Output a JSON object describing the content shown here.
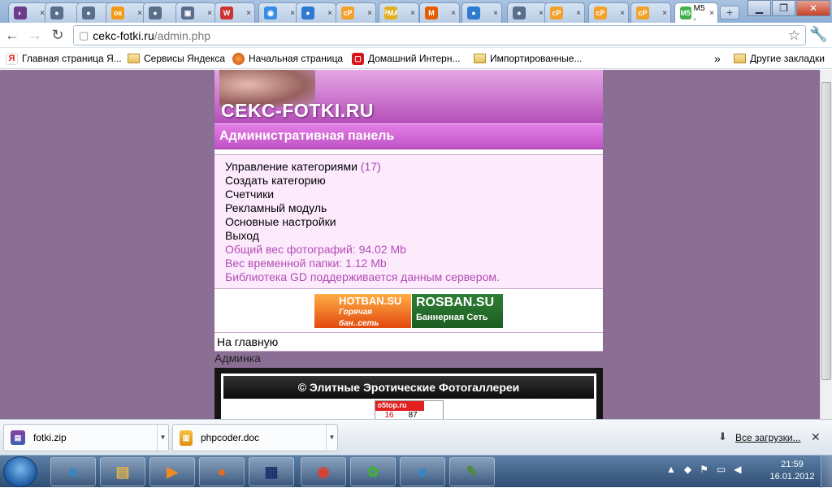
{
  "browser": {
    "tabs": [
      {
        "icon": "chrome-tab-icon",
        "color": "#6d3b8c",
        "glyph": "◐"
      },
      {
        "icon": "globe-tab-icon",
        "color": "#58708a",
        "glyph": "●"
      },
      {
        "icon": "globe-tab-icon",
        "color": "#58708a",
        "glyph": "●"
      },
      {
        "icon": "odnoklassniki-tab-icon",
        "color": "#f49a17",
        "glyph": "ок"
      },
      {
        "icon": "globe-tab-icon",
        "color": "#58708a",
        "glyph": "●"
      },
      {
        "icon": "document-tab-icon",
        "color": "#5b6b8d",
        "glyph": "▣"
      },
      {
        "icon": "colorful-tab-icon",
        "color": "#cc3333",
        "glyph": "W"
      },
      {
        "icon": "chat-tab-icon",
        "color": "#3a8ee6",
        "glyph": "◉"
      },
      {
        "icon": "globe-tab-icon",
        "color": "#2f7ad1",
        "glyph": "●"
      },
      {
        "icon": "cp-tab-icon",
        "color": "#f2a12a",
        "glyph": "cP"
      },
      {
        "icon": "pma-tab-icon",
        "color": "#e0b020",
        "glyph": "PMA"
      },
      {
        "icon": "m-tab-icon",
        "color": "#e65c00",
        "glyph": "M"
      },
      {
        "icon": "globe-tab-icon",
        "color": "#2f7ad1",
        "glyph": "●"
      },
      {
        "icon": "globe-tab-icon",
        "color": "#58708a",
        "glyph": "●"
      },
      {
        "icon": "cp-tab-icon",
        "color": "#f2a12a",
        "glyph": "cP"
      },
      {
        "icon": "cp-tab-icon",
        "color": "#f2a12a",
        "glyph": "cP"
      },
      {
        "icon": "cp-tab-icon",
        "color": "#f2a12a",
        "glyph": "cP"
      },
      {
        "icon": "active-tab-icon",
        "color": "#3fb04a",
        "glyph": "M5"
      }
    ],
    "active_tab_label": "M5 ,",
    "new_tab_label": "+",
    "window_buttons": {
      "minimize": "▁",
      "maximize": "❐",
      "close": "✕"
    },
    "back": "←",
    "forward": "→",
    "reload": "↻",
    "url_host": "cekc-fotki.ru",
    "url_path": "/admin.php",
    "star": "☆",
    "wrench": "🔧",
    "bookmarks": [
      {
        "label": "Главная страница Я...",
        "icon": "yandex-icon"
      },
      {
        "label": "Сервисы Яндекса",
        "icon": "folder-icon"
      },
      {
        "label": "Начальная страница",
        "icon": "firefox-icon"
      },
      {
        "label": "Домашний Интерн...",
        "icon": "home-internet-icon"
      },
      {
        "label": "Импортированные...",
        "icon": "folder-icon"
      }
    ],
    "bookmarks_more": "»",
    "other_bookmarks": "Другие закладки"
  },
  "site": {
    "logo": "CEKC-FOTKI.RU",
    "admin_title": "Административная панель",
    "menu": {
      "manage_categories": "Управление категориями",
      "categories_count": "(17)",
      "create_category": "Создать категорию",
      "counters": "Счетчики",
      "ad_module": "Рекламный модуль",
      "main_settings": "Основные настройки",
      "logout": "Выход"
    },
    "info": {
      "photos_weight": "Общий вес фотографий: 94.02 Mb",
      "temp_weight": "Вес временной папки: 1.12 Mb",
      "gd_support": "Библиотека GD поддерживается данным сервером."
    },
    "ads": {
      "hotban_title": "HOTBAN.SU",
      "hotban_sub1": "Горячая",
      "hotban_sub2": "бан..сеть",
      "rosban_title": "ROSBAN.SU",
      "rosban_sub": "Баннерная Сеть"
    },
    "home_link": "На главную",
    "adminka": "Админка",
    "footer_title": "© Элитные Эротические Фотогаллереи",
    "counter": {
      "brand": "o5top.ru",
      "left": "16",
      "right": "87"
    }
  },
  "downloads": {
    "items": [
      {
        "name": "fotki.zip",
        "icon": "winrar-icon"
      },
      {
        "name": "phpcoder.doc",
        "icon": "document-icon"
      }
    ],
    "all_label": "Все загрузки...",
    "close": "✕"
  },
  "taskbar": {
    "apps": [
      {
        "icon": "internet-explorer-icon",
        "glyph": "e",
        "color": "#1f8bd8"
      },
      {
        "icon": "file-explorer-icon",
        "glyph": "▤",
        "color": "#e0b34a"
      },
      {
        "icon": "media-player-icon",
        "glyph": "▶",
        "color": "#f08a24"
      },
      {
        "icon": "firefox-icon",
        "glyph": "●",
        "color": "#e86a1a"
      },
      {
        "icon": "floppy-save-icon",
        "glyph": "▦",
        "color": "#1a2f6b"
      },
      {
        "icon": "chrome-icon",
        "glyph": "◉",
        "color": "#d9412f"
      },
      {
        "icon": "icq-icon",
        "glyph": "✿",
        "color": "#3fb13b"
      },
      {
        "icon": "internet-explorer-icon",
        "glyph": "e",
        "color": "#1f8bd8"
      },
      {
        "icon": "editor-icon",
        "glyph": "✎",
        "color": "#4d8a3a"
      }
    ],
    "time": "21:59",
    "date": "16.01.2012"
  }
}
